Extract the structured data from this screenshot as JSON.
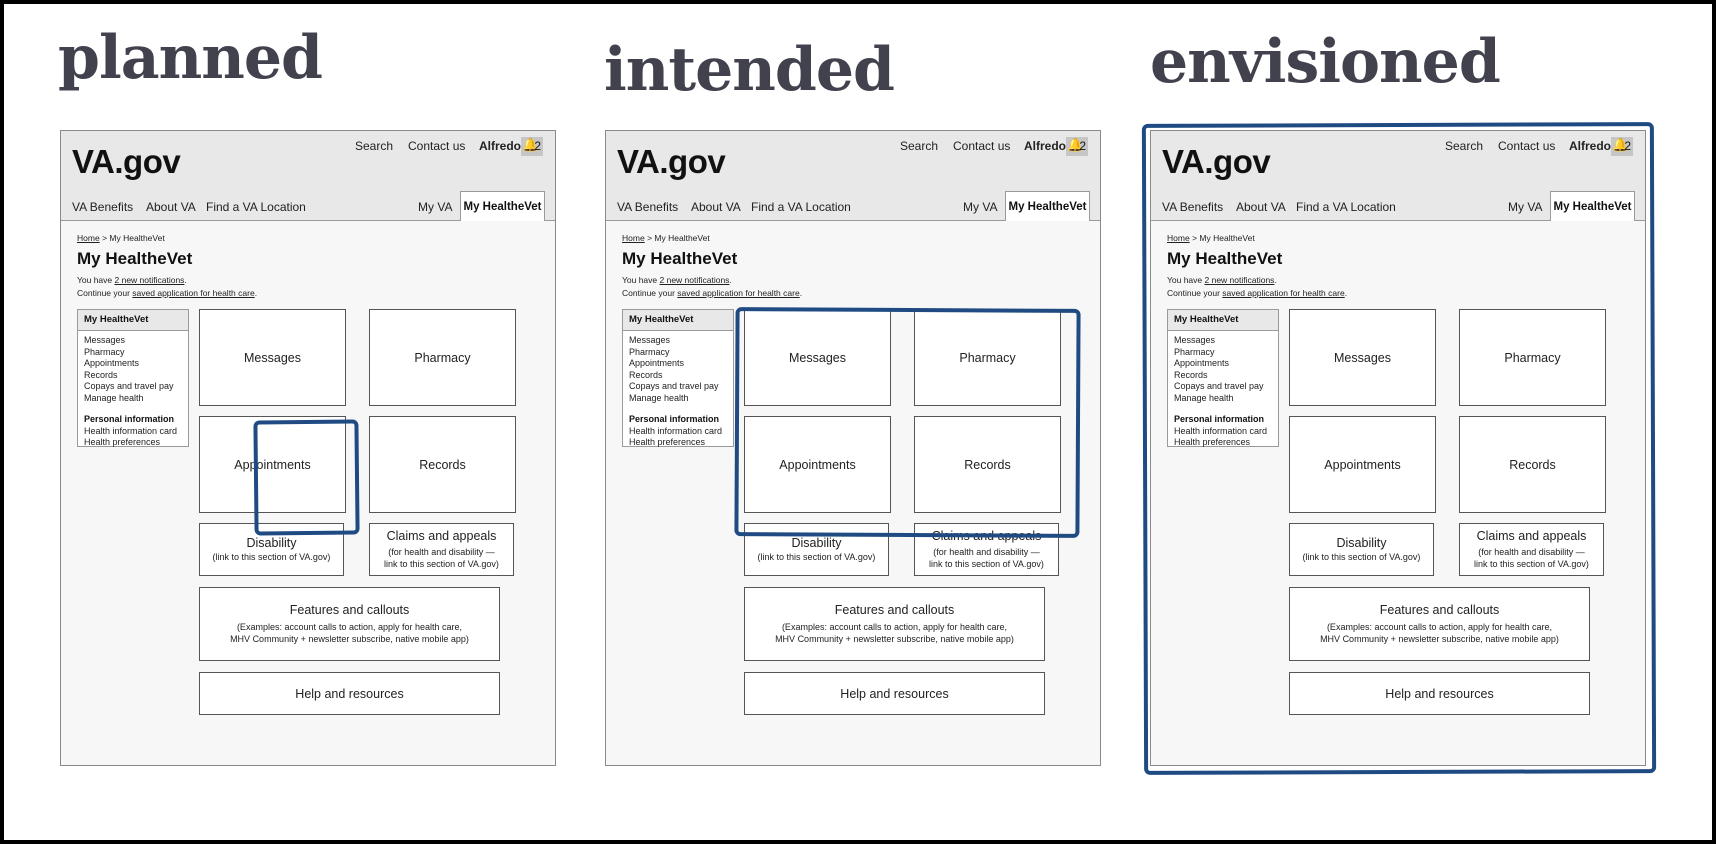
{
  "headings": [
    "planned",
    "intended",
    "envisioned"
  ],
  "highlight_color": "#1f4b82",
  "site": {
    "logo": "VA.gov",
    "search": "Search",
    "contact": "Contact us",
    "user": "Alfredo",
    "notif_icon": "bell-icon",
    "notif_count": "2",
    "nav": [
      "VA Benefits",
      "About VA",
      "Find a VA Location"
    ],
    "my_va": "My VA",
    "my_hv": "My HealtheVet"
  },
  "page": {
    "crumb_home": "Home",
    "crumb_sep": ">",
    "crumb_current": "My HealtheVet",
    "title": "My HealtheVet",
    "notice1_pre": "You have ",
    "notice1_link": "2 new notifications",
    "notice1_post": ".",
    "notice2_pre": "Continue your ",
    "notice2_link": "saved application for health care",
    "notice2_post": "."
  },
  "sidebar": {
    "header": "My HealtheVet",
    "items": [
      "Messages",
      "Pharmacy",
      "Appointments",
      "Records",
      "Copays and travel pay",
      "Manage health"
    ],
    "section": "Personal information",
    "section_items": [
      "Health information card",
      "Health preferences"
    ]
  },
  "tiles": {
    "messages": "Messages",
    "pharmacy": "Pharmacy",
    "appointments": "Appointments",
    "records": "Records",
    "disability": "Disability",
    "disability_sub": "(link to this section of VA.gov)",
    "claims": "Claims and appeals",
    "claims_sub1": "(for health and disability —",
    "claims_sub2": "link to this section of VA.gov)",
    "features": "Features and callouts",
    "features_sub1": "(Examples: account calls to action, apply for health care,",
    "features_sub2": "MHV Community + newsletter subscribe, native mobile app)",
    "help": "Help and resources"
  }
}
